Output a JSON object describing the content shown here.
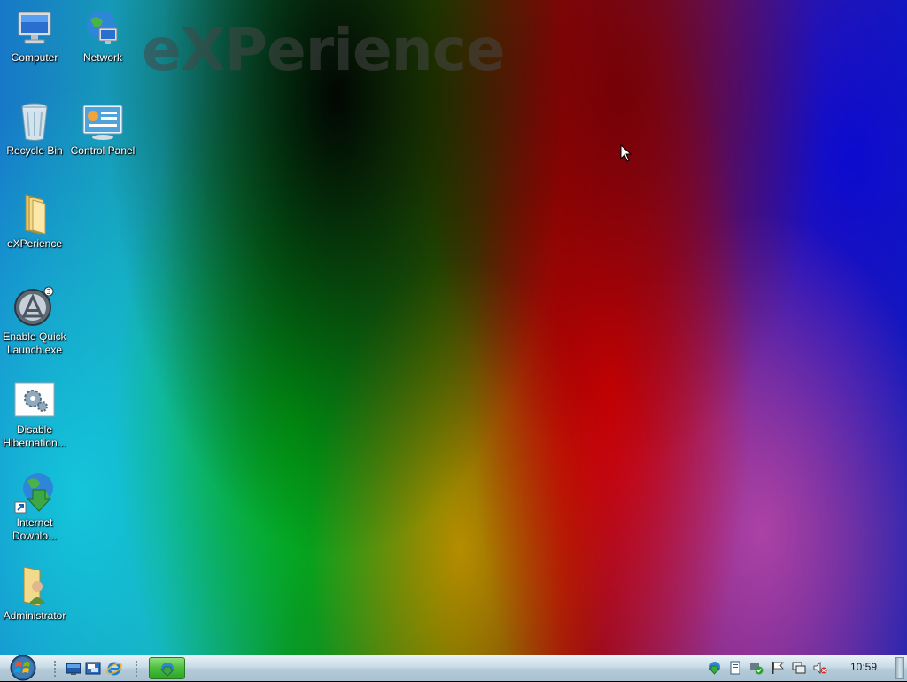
{
  "desktop": {
    "watermark": "eXPerience",
    "icons": [
      {
        "label": "Computer",
        "icon": "computer-icon"
      },
      {
        "label": "Network",
        "icon": "network-globe-icon"
      },
      {
        "label": "Recycle Bin",
        "icon": "recycle-bin-icon"
      },
      {
        "label": "Control Panel",
        "icon": "control-panel-icon"
      },
      {
        "label": "eXPerience",
        "icon": "folder-icon"
      },
      {
        "label": "Enable Quick Launch.exe",
        "icon": "app-launcher-icon"
      },
      {
        "label": "Disable Hibernation...",
        "icon": "settings-gear-icon"
      },
      {
        "label": "Internet Downlo...",
        "icon": "download-manager-icon"
      },
      {
        "label": "Administrator",
        "icon": "user-folder-icon"
      }
    ]
  },
  "taskbar": {
    "quick_launch": [
      "show-desktop-icon",
      "switch-windows-icon",
      "internet-explorer-icon"
    ],
    "tray": [
      "download-manager-tray-icon",
      "clipboard-icon",
      "security-shield-icon",
      "action-center-flag-icon",
      "network-icon",
      "volume-muted-icon"
    ],
    "clock": "10:59"
  },
  "colors": {
    "taskbar_top": "#e9f2f7",
    "taskbar_bottom": "#a9c2d2",
    "active_task": "#4cbe3e"
  }
}
